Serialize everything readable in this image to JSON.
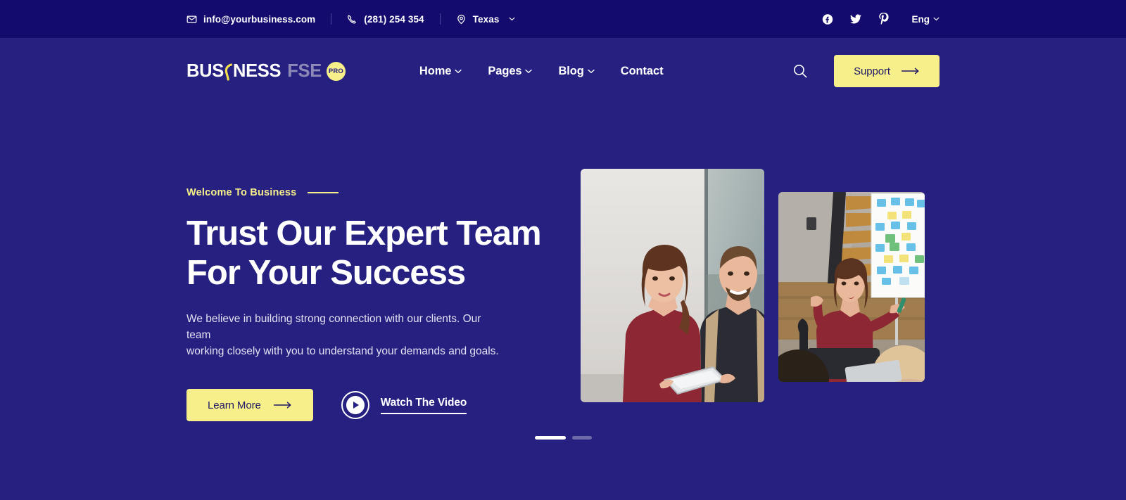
{
  "colors": {
    "topbar_bg": "#130b6d",
    "main_bg": "#262180",
    "accent_yellow": "#f7ef8a",
    "text_white": "#ffffff",
    "muted_logo": "#8e8ab8",
    "dot_inactive": "#6f6aa8"
  },
  "topbar": {
    "email": "info@yourbusiness.com",
    "phone": "(281) 254 354",
    "location": "Texas",
    "email_icon": "envelope-icon",
    "phone_icon": "phone-icon",
    "location_icon": "map-pin-icon",
    "socials": [
      {
        "name": "facebook-icon",
        "label": "Facebook"
      },
      {
        "name": "twitter-icon",
        "label": "Twitter"
      },
      {
        "name": "pinterest-icon",
        "label": "Pinterest"
      }
    ],
    "language": "Eng"
  },
  "header": {
    "logo": {
      "part1": "BUS",
      "part2": "NESS",
      "suffix": "FSE",
      "badge": "PRO"
    },
    "nav": [
      {
        "label": "Home",
        "has_dropdown": true
      },
      {
        "label": "Pages",
        "has_dropdown": true
      },
      {
        "label": "Blog",
        "has_dropdown": true
      },
      {
        "label": "Contact",
        "has_dropdown": false
      }
    ],
    "search_icon": "search-icon",
    "support_label": "Support"
  },
  "hero": {
    "eyebrow": "Welcome To Business",
    "title": "Trust Our Expert Team\nFor Your Success",
    "description": "We believe in building strong connection with our clients. Our team\nworking closely with you to understand your demands and goals.",
    "primary_cta": "Learn More",
    "video_cta": "Watch The Video",
    "image_one_alt": "Two business colleagues reviewing a tablet together",
    "image_two_alt": "Woman presenting at a whiteboard covered in sticky notes"
  },
  "slider": {
    "slides": [
      {
        "active": true
      },
      {
        "active": false
      }
    ]
  }
}
